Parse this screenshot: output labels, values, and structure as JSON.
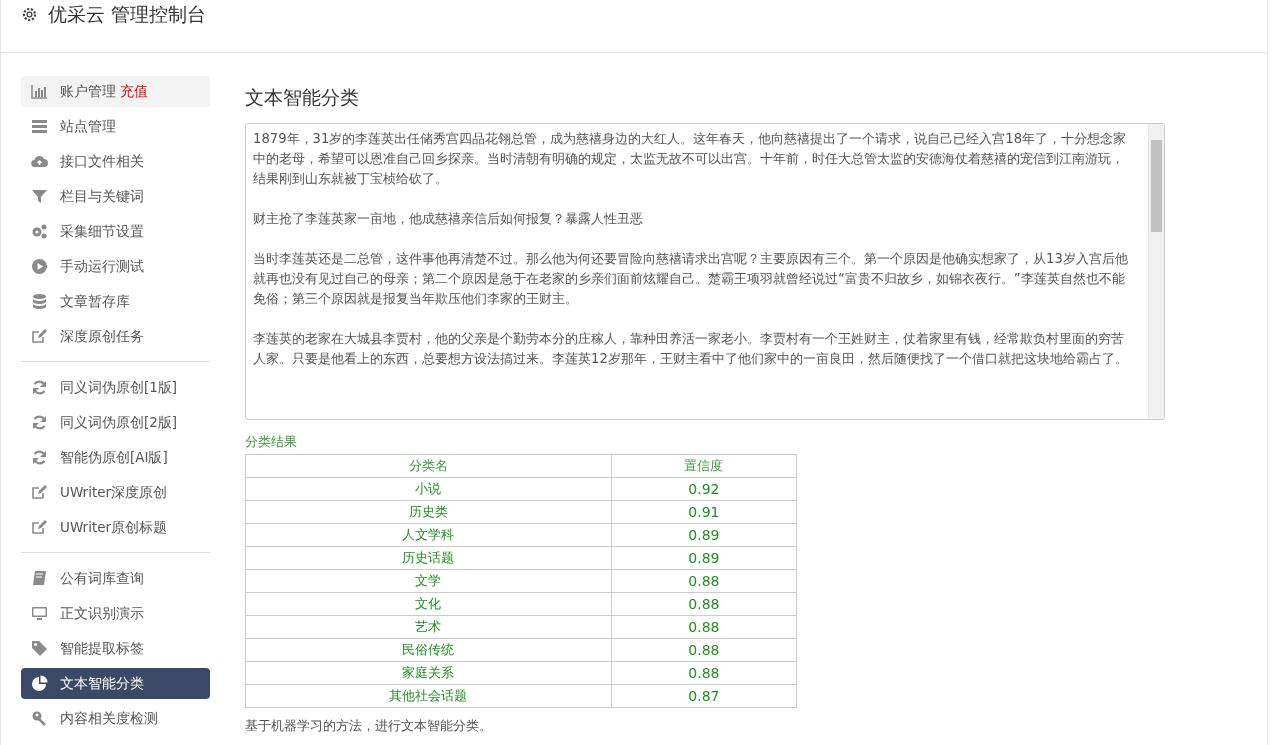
{
  "header": {
    "title": "优采云 管理控制台"
  },
  "sidebar": {
    "groups": [
      [
        {
          "kind": "chart",
          "label": "账户管理",
          "badge": "充值",
          "selected": false,
          "hover": true
        },
        {
          "kind": "server",
          "label": "站点管理",
          "selected": false
        },
        {
          "kind": "cloud",
          "label": "接口文件相关",
          "selected": false
        },
        {
          "kind": "filter",
          "label": "栏目与关键词",
          "selected": false
        },
        {
          "kind": "gears",
          "label": "采集细节设置",
          "selected": false
        },
        {
          "kind": "play",
          "label": "手动运行测试",
          "selected": false
        },
        {
          "kind": "database",
          "label": "文章暂存库",
          "selected": false
        },
        {
          "kind": "edit",
          "label": "深度原创任务",
          "selected": false
        }
      ],
      [
        {
          "kind": "refresh",
          "label": "同义词伪原创[1版]",
          "selected": false
        },
        {
          "kind": "refresh",
          "label": "同义词伪原创[2版]",
          "selected": false
        },
        {
          "kind": "refresh",
          "label": "智能伪原创[AI版]",
          "selected": false
        },
        {
          "kind": "edit",
          "label": "UWriter深度原创",
          "selected": false
        },
        {
          "kind": "edit",
          "label": "UWriter原创标题",
          "selected": false
        }
      ],
      [
        {
          "kind": "book",
          "label": "公有词库查询",
          "selected": false
        },
        {
          "kind": "monitor",
          "label": "正文识别演示",
          "selected": false
        },
        {
          "kind": "tag",
          "label": "智能提取标签",
          "selected": false
        },
        {
          "kind": "pie",
          "label": "文本智能分类",
          "selected": true
        },
        {
          "kind": "key",
          "label": "内容相关度检测",
          "selected": false
        }
      ]
    ]
  },
  "main": {
    "title": "文本智能分类",
    "text_area": {
      "paragraphs": [
        "1879年，31岁的李莲英出任储秀宫四品花翎总管，成为慈禧身边的大红人。这年春天，他向慈禧提出了一个请求，说自己已经入宫18年了，十分想念家中的老母，希望可以恩准自己回乡探亲。当时清朝有明确的规定，太监无故不可以出宫。十年前，时任大总管太监的安德海仗着慈禧的宠信到江南游玩，结果刚到山东就被丁宝桢给砍了。",
        "财主抢了李莲英家一亩地，他成慈禧亲信后如何报复？暴露人性丑恶",
        "当时李莲英还是二总管，这件事他再清楚不过。那么他为何还要冒险向慈禧请求出宫呢？主要原因有三个。第一个原因是他确实想家了，从13岁入宫后他就再也没有见过自己的母亲；第二个原因是急于在老家的乡亲们面前炫耀自己。楚霸王项羽就曾经说过“富贵不归故乡，如锦衣夜行。”李莲英自然也不能免俗；第三个原因就是报复当年欺压他们李家的王财主。",
        "李莲英的老家在大城县李贾村，他的父亲是个勤劳本分的庄稼人，靠种田养活一家老小。李贾村有一个王姓财主，仗着家里有钱，经常欺负村里面的穷苦人家。只要是他看上的东西，总要想方设法搞过来。李莲英12岁那年，王财主看中了他们家中的一亩良田，然后随便找了一个借口就把这块地给霸占了。"
      ]
    },
    "result_label": "分类结果",
    "table": {
      "columns": [
        "分类名",
        "置信度"
      ],
      "rows": [
        [
          "小说",
          "0.92"
        ],
        [
          "历史类",
          "0.91"
        ],
        [
          "人文学科",
          "0.89"
        ],
        [
          "历史话题",
          "0.89"
        ],
        [
          "文学",
          "0.88"
        ],
        [
          "文化",
          "0.88"
        ],
        [
          "艺术",
          "0.88"
        ],
        [
          "民俗传统",
          "0.88"
        ],
        [
          "家庭关系",
          "0.88"
        ],
        [
          "其他社会话题",
          "0.87"
        ]
      ]
    },
    "note": "基于机器学习的方法，进行文本智能分类。"
  }
}
